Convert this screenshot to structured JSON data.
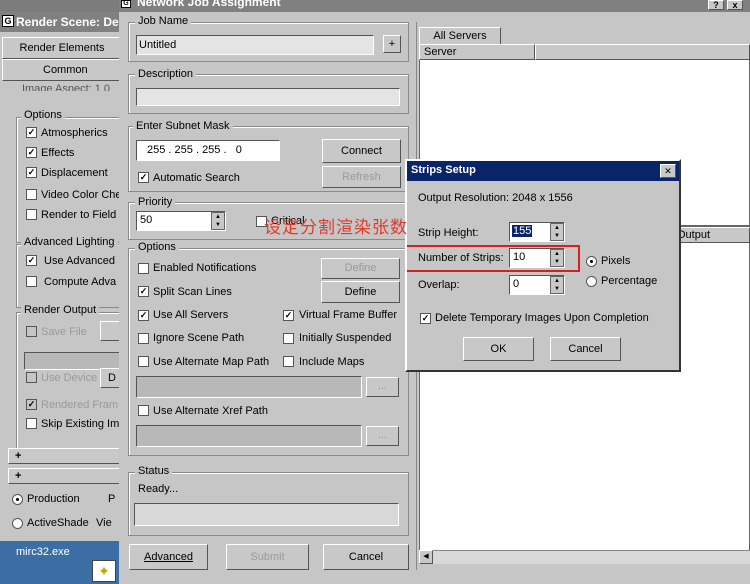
{
  "render_scene": {
    "title": "Render Scene: De",
    "tabs": [
      "Render Elements",
      "Common"
    ],
    "cut_text": "Image Aspect: 1.0",
    "options_label": "Options",
    "options": [
      {
        "label": "Atmospherics",
        "checked": true
      },
      {
        "label": "Effects",
        "checked": true
      },
      {
        "label": "Displacement",
        "checked": true
      },
      {
        "label": "Video Color Che",
        "checked": false
      },
      {
        "label": "Render to Field",
        "checked": false
      }
    ],
    "adv_label": "Advanced Lighting",
    "adv": [
      {
        "label": "Use Advanced",
        "checked": true
      },
      {
        "label": "Compute Adva",
        "checked": false
      }
    ],
    "output_label": "Render Output",
    "save_file": "Save File",
    "use_device": "Use Device",
    "use_device_btn": "D",
    "rendered_frame": "Rendered Fram",
    "skip_existing": "Skip Existing Im",
    "plus1": "+",
    "plus2": "+",
    "production": "Production",
    "activeshade": "ActiveShade",
    "p_char": "P",
    "view_char": "Vie"
  },
  "taskbar": {
    "item": "mirc32.exe"
  },
  "nja": {
    "title": "Network Job Assignment",
    "close_glyph": "x",
    "help_glyph": "?",
    "job_name_label": "Job Name",
    "job_name_value": "Untitled",
    "plus_btn": "+",
    "description_label": "Description",
    "subnet_label": "Enter Subnet Mask",
    "subnet": [
      "255",
      "255",
      "255",
      "0"
    ],
    "connect": "Connect",
    "auto_search": "Automatic Search",
    "refresh": "Refresh",
    "priority_label": "Priority",
    "priority_value": "50",
    "critical": "Critical",
    "options_label": "Options",
    "enabled_notifications": "Enabled Notifications",
    "define_dis": "Define",
    "split_scan": "Split Scan Lines",
    "define": "Define",
    "use_all_servers": "Use All Servers",
    "virtual_fb": "Virtual Frame Buffer",
    "ignore_scene": "Ignore Scene Path",
    "init_suspended": "Initially Suspended",
    "alt_map": "Use Alternate Map Path",
    "include_maps": "Include Maps",
    "browse1": "...",
    "alt_xref": "Use Alternate Xref Path",
    "browse2": "...",
    "status_label": "Status",
    "status_value": "Ready...",
    "advanced": "Advanced",
    "submit": "Submit",
    "cancel": "Cancel",
    "servers_tab": "All Servers",
    "server_col": "Server",
    "output_col": "Output"
  },
  "strips": {
    "title": "Strips Setup",
    "close": "✕",
    "resolution": "Output Resolution: 2048 x 1556",
    "strip_height_label": "Strip Height:",
    "strip_height": "155",
    "num_strips_label": "Number of Strips:",
    "num_strips": "10",
    "overlap_label": "Overlap:",
    "overlap": "0",
    "pixels": "Pixels",
    "percentage": "Percentage",
    "delete_temp": "Delete Temporary Images Upon Completion",
    "ok": "OK",
    "cancel": "Cancel"
  },
  "annotation": "设定分割渲染张数",
  "colors": {
    "annotation": "#e03a2e",
    "title_active": "#0a246a"
  }
}
